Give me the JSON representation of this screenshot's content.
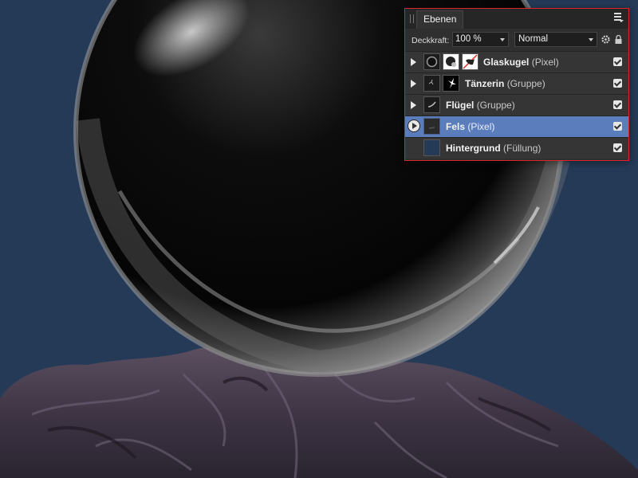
{
  "panel": {
    "tab_label": "Ebenen",
    "opacity_label": "Deckkraft:",
    "opacity_value": "100 %",
    "blend_mode": "Normal"
  },
  "layers": [
    {
      "name": "Glaskugel",
      "type": "(Pixel)",
      "expandable": true,
      "selected": false,
      "visible": true
    },
    {
      "name": "Tänzerin",
      "type": "(Gruppe)",
      "expandable": true,
      "selected": false,
      "visible": true
    },
    {
      "name": "Flügel",
      "type": "(Gruppe)",
      "expandable": true,
      "selected": false,
      "visible": true
    },
    {
      "name": "Fels",
      "type": "(Pixel)",
      "expandable": true,
      "selected": true,
      "visible": true
    },
    {
      "name": "Hintergrund",
      "type": "(Füllung)",
      "expandable": false,
      "selected": false,
      "visible": true
    }
  ],
  "colors": {
    "background": "#243a57",
    "selection": "#5c7dbb",
    "panel_highlight_border": "#d9262b"
  },
  "icons": {
    "panel_menu": "hamburger-menu-icon",
    "settings": "gear-icon",
    "lock": "lock-icon",
    "visibility": "checkbox-icon",
    "expander": "triangle-right-icon"
  }
}
